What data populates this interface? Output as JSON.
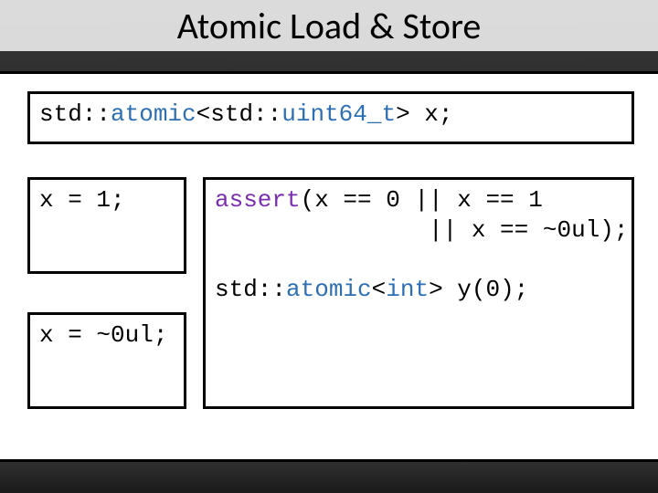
{
  "title": "Atomic Load & Store",
  "decl": {
    "p1": "std::",
    "p2": "atomic",
    "p3": "<std::",
    "p4": "uint64_t",
    "p5": "> x;"
  },
  "leftA": "x = 1;",
  "leftB": "x = ~0ul;",
  "right": {
    "assert_kw": "assert",
    "l1_after": "(x == 0 || x == 1",
    "l2_pad": "               ",
    "l2_after": "|| x == ~0ul);",
    "std_pre": "std::",
    "atomic_kw": "atomic",
    "int_pre": "<",
    "int_kw": "int",
    "int_post": "> y(0);"
  }
}
